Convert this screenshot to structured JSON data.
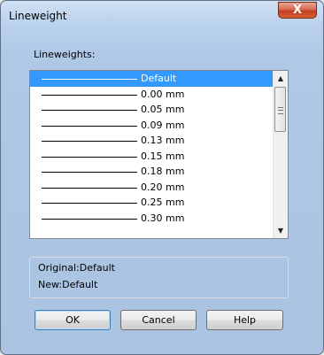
{
  "window": {
    "title": "Lineweight",
    "close_glyph": "X"
  },
  "list": {
    "label": "Lineweights:",
    "selected_index": 0,
    "items": [
      {
        "label": "Default"
      },
      {
        "label": "0.00  mm"
      },
      {
        "label": "0.05  mm"
      },
      {
        "label": "0.09  mm"
      },
      {
        "label": "0.13  mm"
      },
      {
        "label": "0.15  mm"
      },
      {
        "label": "0.18  mm"
      },
      {
        "label": "0.20  mm"
      },
      {
        "label": "0.25  mm"
      },
      {
        "label": "0.30  mm"
      }
    ],
    "scroll_up_glyph": "▲",
    "scroll_down_glyph": "▼"
  },
  "info": {
    "original": "Original:Default",
    "new": "New:Default"
  },
  "buttons": {
    "ok": "OK",
    "cancel": "Cancel",
    "help": "Help"
  }
}
